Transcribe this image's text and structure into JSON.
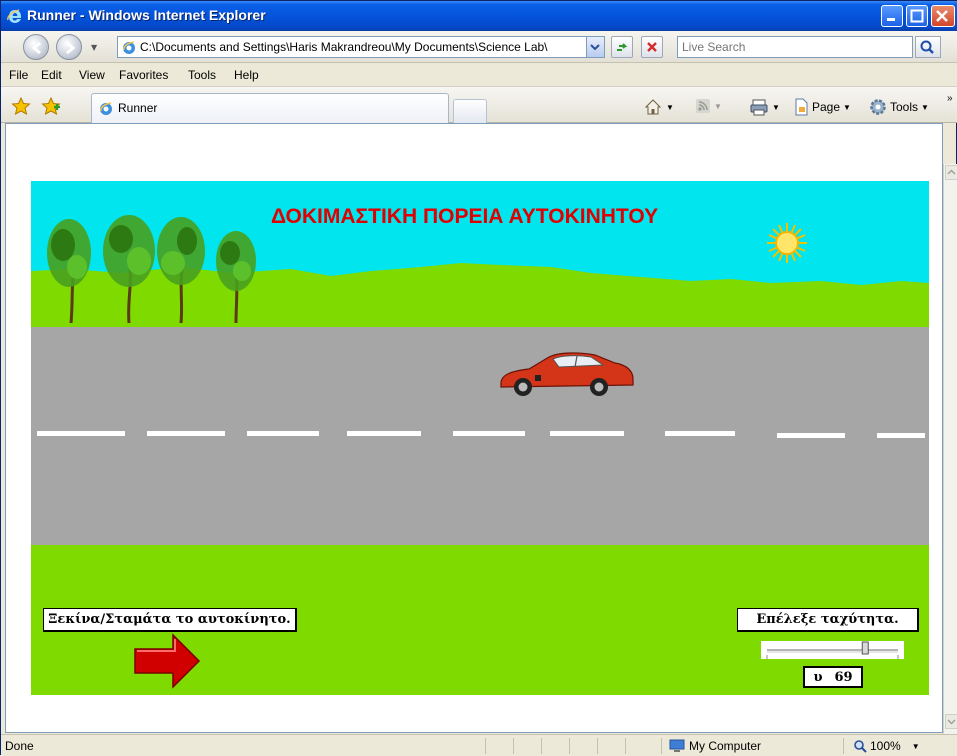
{
  "window": {
    "title": "Runner - Windows Internet Explorer"
  },
  "navigation": {
    "address": "C:\\Documents and Settings\\Haris Makrandreou\\My Documents\\Science Lab\\",
    "search_placeholder": "Live Search"
  },
  "menu": [
    "File",
    "Edit",
    "View",
    "Favorites",
    "Tools",
    "Help"
  ],
  "tabs": {
    "active_label": "Runner"
  },
  "commands": {
    "page_label": "Page",
    "tools_label": "Tools"
  },
  "simulation": {
    "heading": "ΔΟΚΙΜΑΣΤΙΚΗ ΠΟΡΕΙΑ ΑΥΤΟΚΙΝΗΤΟΥ",
    "start_stop_label": "Ξεκίνα/Σταμάτα το αυτοκίνητο.",
    "speed_label": "Επέλεξε ταχύτητα.",
    "speed_symbol": "υ",
    "speed_value": "69",
    "slider_fraction": 0.75
  },
  "status": {
    "left": "Done",
    "zone": "My Computer",
    "zoom": "100%"
  },
  "colors": {
    "sky": "#00E5EE",
    "grass": "#7FDA00",
    "road": "#A6A6A6",
    "heading": "#E00000",
    "car": "#D43518",
    "arrow": "#D00000"
  }
}
